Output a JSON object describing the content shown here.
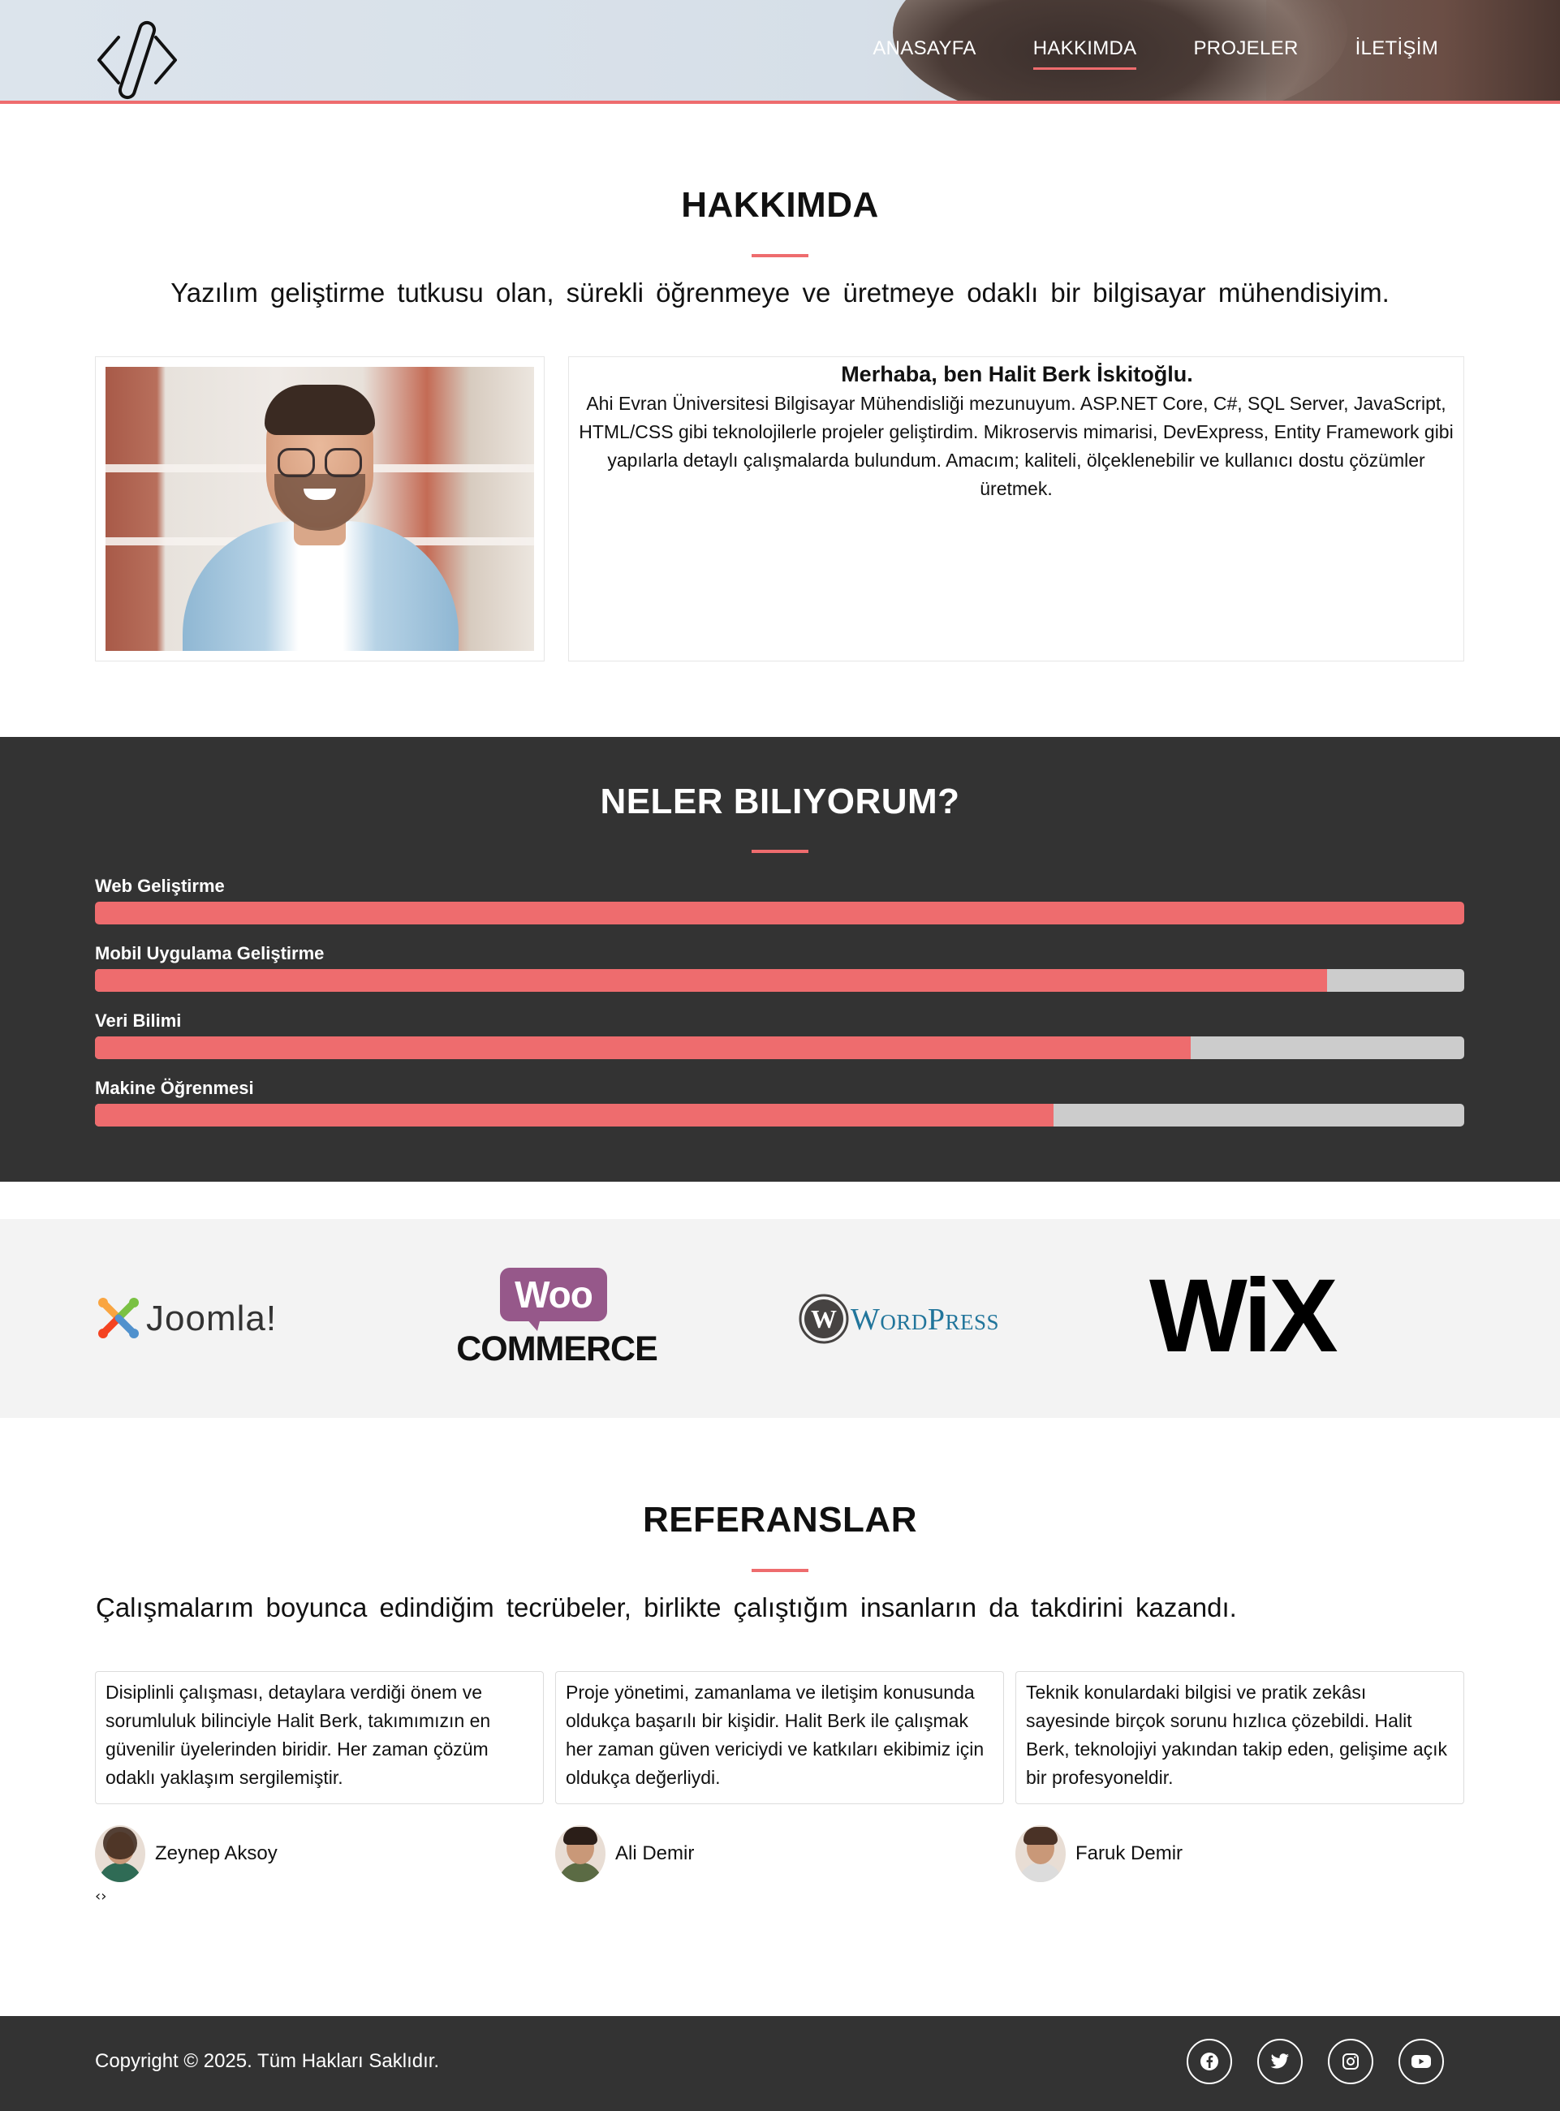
{
  "nav": {
    "items": [
      {
        "label": "ANASAYFA",
        "active": false
      },
      {
        "label": "HAKKIMDA",
        "active": true
      },
      {
        "label": "PROJELER",
        "active": false
      },
      {
        "label": "İLETİŞİM",
        "active": false
      }
    ]
  },
  "logo": {
    "icon": "code-icon"
  },
  "about": {
    "title": "HAKKIMDA",
    "lead": "Yazılım geliştirme tutkusu olan, sürekli öğrenmeye ve üretmeye odaklı bir bilgisayar mühendisiyim.",
    "name": "Merhaba, ben Halit Berk İskitoğlu.",
    "bio": "Ahi Evran Üniversitesi Bilgisayar Mühendisliği mezunuyum. ASP.NET Core, C#, SQL Server, JavaScript, HTML/CSS gibi teknolojilerle projeler geliştirdim. Mikroservis mimarisi, DevExpress, Entity Framework gibi yapılarla detaylı çalışmalarda bulundum. Amacım; kaliteli, ölçeklenebilir ve kullanıcı dostu çözümler üretmek."
  },
  "skills": {
    "title": "NELER BILIYORUM?",
    "items": [
      {
        "label": "Web Geliştirme",
        "percent": 100
      },
      {
        "label": "Mobil Uygulama Geliştirme",
        "percent": 90
      },
      {
        "label": "Veri Bilimi",
        "percent": 80
      },
      {
        "label": "Makine Öğrenmesi",
        "percent": 70
      }
    ]
  },
  "brands": {
    "joomla": "Joomla!",
    "woo_top": "Woo",
    "woo_bottom": "COMMERCE",
    "wordpress": "WordPress",
    "wix": "WiX"
  },
  "references": {
    "title": "REFERANSLAR",
    "lead": "Çalışmalarım boyunca edindiğim tecrübeler, birlikte çalıştığım insanların da takdirini kazandı.",
    "items": [
      {
        "text": "Disiplinli çalışması, detaylara verdiği önem ve sorumluluk bilinciyle Halit Berk, takımımızın en güvenilir üyelerinden biridir. Her zaman çözüm odaklı yaklaşım sergilemiştir.",
        "name": "Zeynep Aksoy"
      },
      {
        "text": "Proje yönetimi, zamanlama ve iletişim konusunda oldukça başarılı bir kişidir. Halit Berk ile çalışmak her zaman güven vericiydi ve katkıları ekibimiz için oldukça değerliydi.",
        "name": "Ali Demir"
      },
      {
        "text": "Teknik konulardaki bilgisi ve pratik zekâsı sayesinde birçok sorunu hızlıca çözebildi. Halit Berk, teknolojiyi yakından takip eden, gelişime açık bir profesyoneldir.",
        "name": "Faruk Demir"
      }
    ],
    "nav_glyph": "‹›"
  },
  "footer": {
    "copyright": "Copyright © 2025. Tüm Hakları Saklıdır.",
    "social": [
      "facebook-icon",
      "twitter-icon",
      "instagram-icon",
      "youtube-icon"
    ]
  },
  "colors": {
    "accent": "#ee6c6e",
    "dark": "#333333",
    "light": "#f3f3f3"
  }
}
